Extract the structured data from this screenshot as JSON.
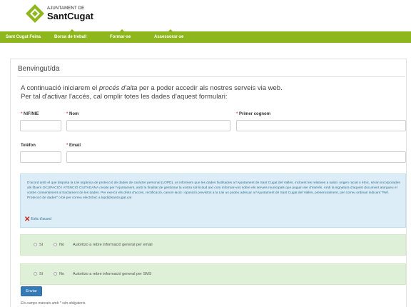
{
  "header": {
    "logo_small": "AJUNTAMENT DE",
    "logo_big": "SantCugat"
  },
  "nav": {
    "items": [
      {
        "label": "Sant Cugat Feina"
      },
      {
        "label": "Borsa de treball"
      },
      {
        "label": "Formar-se"
      },
      {
        "label": "Assessorar-se"
      }
    ]
  },
  "page": {
    "title": "Benvingut/da",
    "intro_line1_pre": "A continuació iniciarem el ",
    "intro_line1_em": "procés d'alta",
    "intro_line1_post": " per a poder accedir als nostres serveis via web.",
    "intro_line2": "Per tal d'activar l'accés, cal omplir totes les dades d'aquest formulari:"
  },
  "form": {
    "required_mark": "*",
    "nif_label": "NIF/NIE",
    "nom_label": "Nom",
    "cognom_label": "Primer cognom",
    "telefon_label": "Telèfon",
    "email_label": "Email",
    "nif_value": "",
    "nom_value": "",
    "cognom_value": "",
    "telefon_value": "",
    "email_value": ""
  },
  "lopd": {
    "text": "D'acord amb el que disposa la Llei orgànica de protecció de dades de caràcter personal (LOPD), us informem que les dades facilitades a l'Ajuntament de Sant Cugat del Vallès, incloent les relatives a salut i origen racial o ètnic, seran incorporades als fitxers OCUPACIÓ I ATENCIÓ CIUTADANA creats per l'Ajuntament, amb la finalitat de gestionar la vostra sol·licitud així com informar-vos sobre els serveis municipals que puguin ser d'interès. Amb la signatura d'aquest document atorgueu el vostre consentiment al tractament de les dades. Per exercir els drets d'accés, rectificació, cancel·lació i oposició previstos a la Llei us podeu adreçar a l'Ajuntament de Sant Cugat del Vallès, presencialment, per correu ordinari indicant \"Ref. Protecció de dades\" o bé per correu electrònic a lopd@santcugat.cat",
    "agree_icon": "cross-icon",
    "agree_label": "Estic d'acord"
  },
  "consent_email": {
    "yes": "Sí",
    "no": "No",
    "label": "Autoritzo a rebre informació general per email"
  },
  "consent_sms": {
    "yes": "Sí",
    "no": "No",
    "label": "Autoritzo a rebre informació general per SMS"
  },
  "submit_label": "Enviar",
  "footnote": "Els camps marcats amb * són obligatoris.",
  "colors": {
    "nav_green": "#8db71c",
    "info_blue": "#dcedf7",
    "consent_green": "#dff0d8",
    "button_blue": "#337ab7",
    "required_red": "#d9534f"
  }
}
